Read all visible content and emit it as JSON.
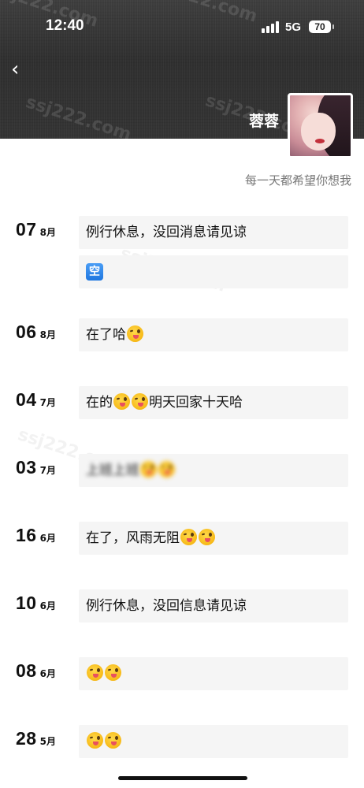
{
  "status_bar": {
    "time": "12:40",
    "network": "5G",
    "battery": "70"
  },
  "header": {
    "back_glyph": "‹",
    "user_name": "蓉蓉",
    "signature": "每一天都希望你想我",
    "watermark": "ssj222.com"
  },
  "posts": [
    {
      "day": "07",
      "month": "8月",
      "text": "例行休息，没回消息请见谅",
      "extra_icon": "空"
    },
    {
      "day": "06",
      "month": "8月",
      "text": "在了哈",
      "emoji_count": 1
    },
    {
      "day": "04",
      "month": "7月",
      "text_before": "在的",
      "emoji_count": 2,
      "text_after": "明天回家十天哈"
    },
    {
      "day": "03",
      "month": "7月",
      "text": "上班上班",
      "emoji_count": 2
    },
    {
      "day": "16",
      "month": "6月",
      "text": "在了，风雨无阻",
      "emoji_count": 2
    },
    {
      "day": "10",
      "month": "6月",
      "text": "例行休息，没回信息请见谅"
    },
    {
      "day": "08",
      "month": "6月",
      "text": "",
      "emoji_count": 2
    },
    {
      "day": "28",
      "month": "5月",
      "text": "",
      "emoji_count": 2
    }
  ],
  "icons": {
    "back": "chevron-left-icon",
    "signal": "signal-icon",
    "battery": "battery-icon",
    "emoji": "wink-tongue-emoji-icon",
    "kong": "kong-badge-icon"
  }
}
